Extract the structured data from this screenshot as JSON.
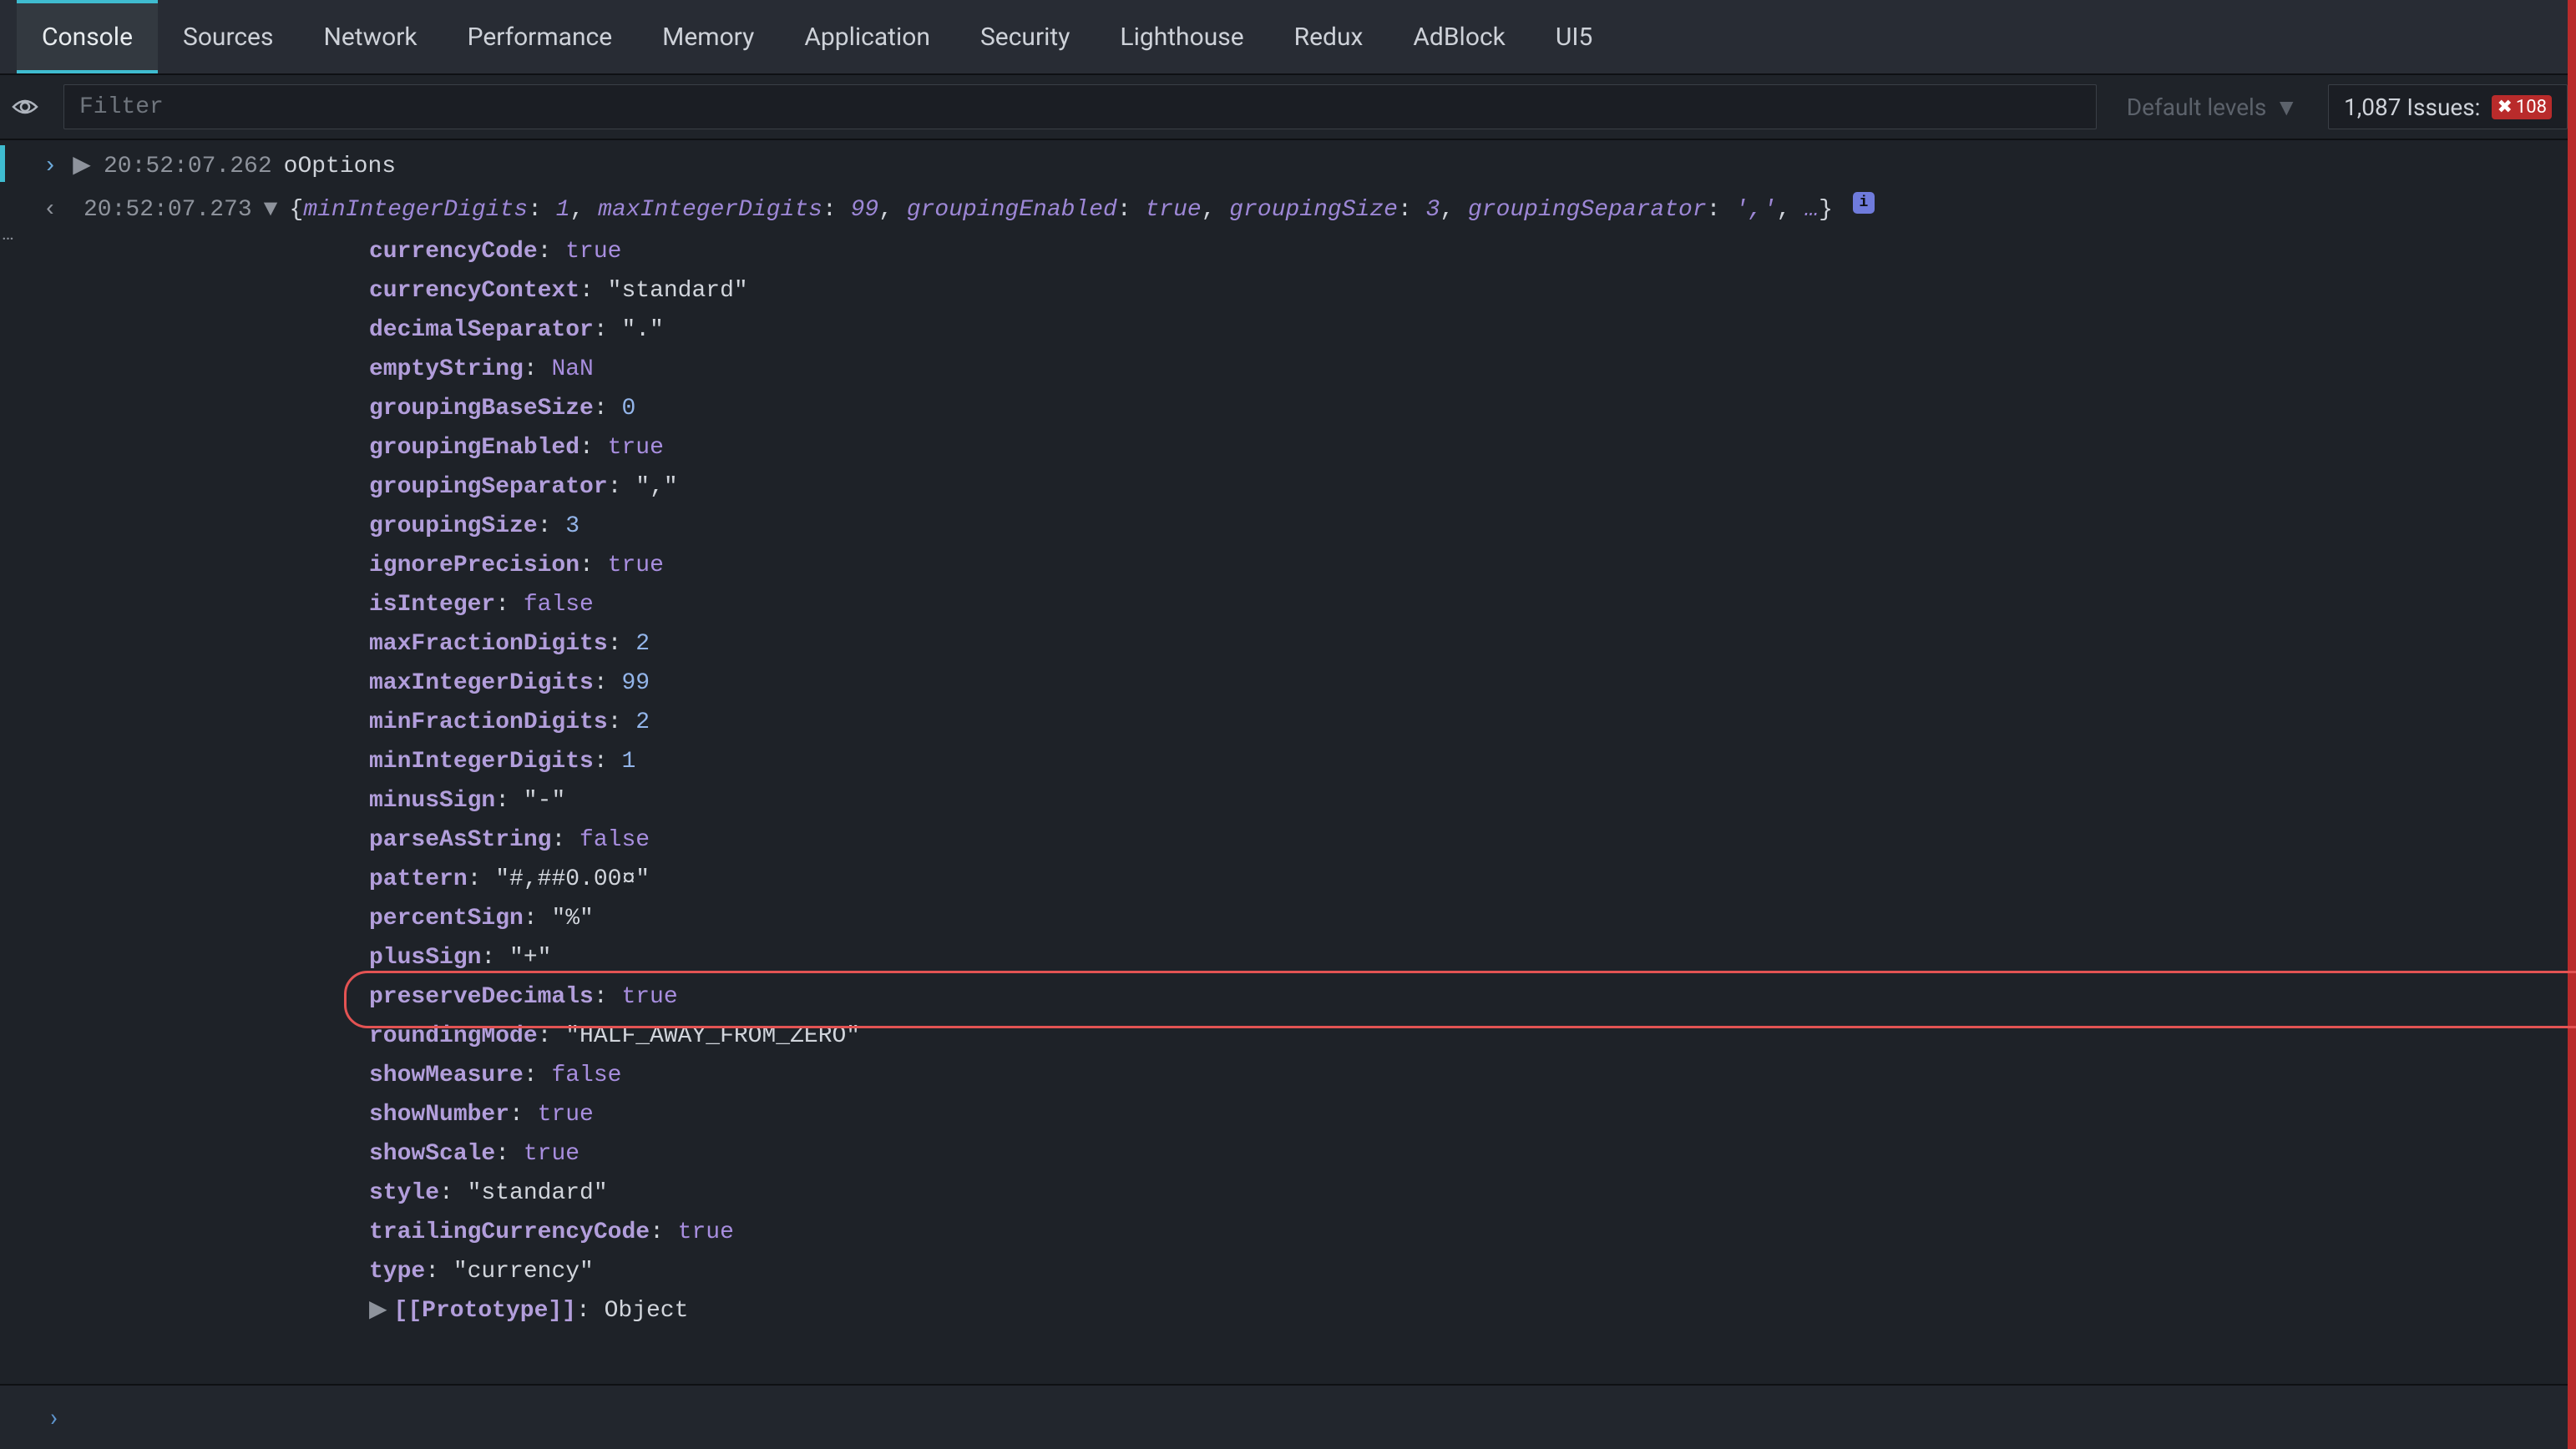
{
  "tabs": [
    "Console",
    "Sources",
    "Network",
    "Performance",
    "Memory",
    "Application",
    "Security",
    "Lighthouse",
    "Redux",
    "AdBlock",
    "UI5"
  ],
  "activeTab": "Console",
  "toolbar": {
    "filterPlaceholder": "Filter",
    "levelsLabel": "Default levels",
    "issuesLabel": "1,087 Issues:",
    "errorCount": "108"
  },
  "log1": {
    "timestamp": "20:52:07.262",
    "name": "oOptions"
  },
  "log2": {
    "timestamp": "20:52:07.273",
    "preview": {
      "k0": "minIntegerDigits",
      "v0": "1",
      "k1": "maxIntegerDigits",
      "v1": "99",
      "k2": "groupingEnabled",
      "v2": "true",
      "k3": "groupingSize",
      "v3": "3",
      "k4": "groupingSeparator",
      "v4": "','",
      "ell": "…"
    }
  },
  "props": [
    {
      "key": "currencyCode",
      "type": "bool",
      "value": "true"
    },
    {
      "key": "currencyContext",
      "type": "str",
      "value": "\"standard\""
    },
    {
      "key": "decimalSeparator",
      "type": "str",
      "value": "\".\""
    },
    {
      "key": "emptyString",
      "type": "nan",
      "value": "NaN"
    },
    {
      "key": "groupingBaseSize",
      "type": "num",
      "value": "0"
    },
    {
      "key": "groupingEnabled",
      "type": "bool",
      "value": "true"
    },
    {
      "key": "groupingSeparator",
      "type": "str",
      "value": "\",\""
    },
    {
      "key": "groupingSize",
      "type": "num",
      "value": "3"
    },
    {
      "key": "ignorePrecision",
      "type": "bool",
      "value": "true"
    },
    {
      "key": "isInteger",
      "type": "bool",
      "value": "false"
    },
    {
      "key": "maxFractionDigits",
      "type": "num",
      "value": "2"
    },
    {
      "key": "maxIntegerDigits",
      "type": "num",
      "value": "99"
    },
    {
      "key": "minFractionDigits",
      "type": "num",
      "value": "2"
    },
    {
      "key": "minIntegerDigits",
      "type": "num",
      "value": "1"
    },
    {
      "key": "minusSign",
      "type": "str",
      "value": "\"-\""
    },
    {
      "key": "parseAsString",
      "type": "bool",
      "value": "false"
    },
    {
      "key": "pattern",
      "type": "str",
      "value": "\"#,##0.00¤\""
    },
    {
      "key": "percentSign",
      "type": "str",
      "value": "\"%\""
    },
    {
      "key": "plusSign",
      "type": "str",
      "value": "\"+\""
    },
    {
      "key": "preserveDecimals",
      "type": "bool",
      "value": "true",
      "highlight": true
    },
    {
      "key": "roundingMode",
      "type": "str",
      "value": "\"HALF_AWAY_FROM_ZERO\""
    },
    {
      "key": "showMeasure",
      "type": "bool",
      "value": "false"
    },
    {
      "key": "showNumber",
      "type": "bool",
      "value": "true"
    },
    {
      "key": "showScale",
      "type": "bool",
      "value": "true"
    },
    {
      "key": "style",
      "type": "str",
      "value": "\"standard\""
    },
    {
      "key": "trailingCurrencyCode",
      "type": "bool",
      "value": "true"
    },
    {
      "key": "type",
      "type": "str",
      "value": "\"currency\""
    }
  ],
  "proto": {
    "key": "[[Prototype]]",
    "value": "Object"
  }
}
